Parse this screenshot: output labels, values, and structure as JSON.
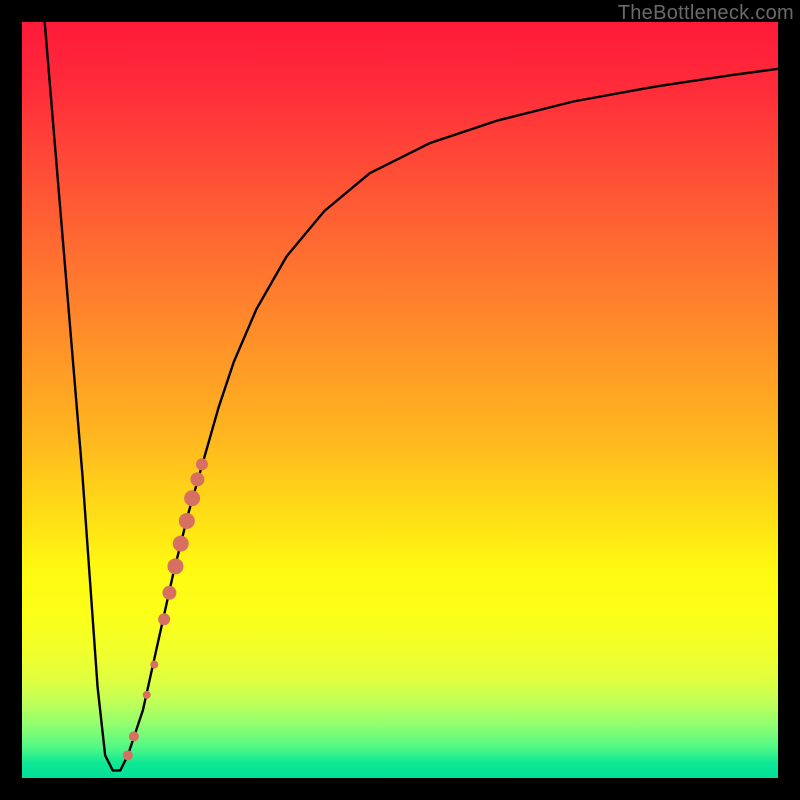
{
  "watermark": "TheBottleneck.com",
  "chart_data": {
    "type": "line",
    "title": "",
    "xlabel": "",
    "ylabel": "",
    "xlim": [
      0,
      100
    ],
    "ylim": [
      0,
      100
    ],
    "series": [
      {
        "name": "curve",
        "x": [
          3,
          8,
          10,
          11,
          12,
          13,
          14,
          16,
          18,
          20,
          22,
          24,
          26,
          28,
          31,
          35,
          40,
          46,
          54,
          63,
          73,
          84,
          94,
          100
        ],
        "values": [
          100,
          40,
          12,
          3,
          1,
          1,
          3,
          9,
          18,
          27,
          35,
          42,
          49,
          55,
          62,
          69,
          75,
          80,
          84,
          87,
          89.5,
          91.5,
          93,
          93.8
        ]
      }
    ],
    "markers": [
      {
        "x": 14.0,
        "y": 3.0,
        "r": 5
      },
      {
        "x": 14.8,
        "y": 5.5,
        "r": 5
      },
      {
        "x": 16.5,
        "y": 11.0,
        "r": 4
      },
      {
        "x": 17.5,
        "y": 15.0,
        "r": 4
      },
      {
        "x": 18.8,
        "y": 21.0,
        "r": 6
      },
      {
        "x": 19.5,
        "y": 24.5,
        "r": 7
      },
      {
        "x": 20.3,
        "y": 28.0,
        "r": 8
      },
      {
        "x": 21.0,
        "y": 31.0,
        "r": 8
      },
      {
        "x": 21.8,
        "y": 34.0,
        "r": 8
      },
      {
        "x": 22.5,
        "y": 37.0,
        "r": 8
      },
      {
        "x": 23.2,
        "y": 39.5,
        "r": 7
      },
      {
        "x": 23.8,
        "y": 41.5,
        "r": 6
      }
    ],
    "marker_color": "#d77061"
  }
}
